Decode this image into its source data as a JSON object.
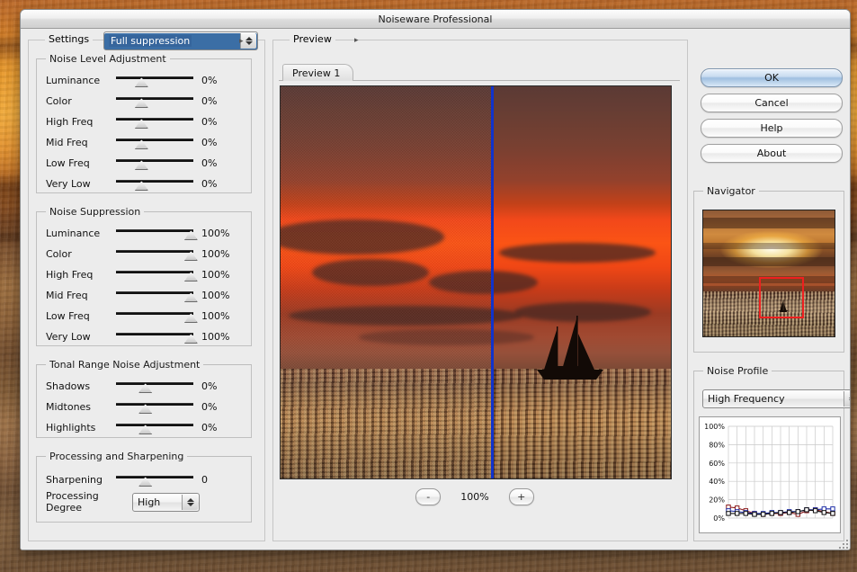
{
  "window": {
    "title": "Noiseware Professional"
  },
  "settings": {
    "group_label": "Settings",
    "preset_value": "Full suppression",
    "expand_arrow": "▸"
  },
  "noise_level": {
    "group_label": "Noise Level Adjustment",
    "rows": [
      {
        "label": "Luminance",
        "value": "0%",
        "pos": 33
      },
      {
        "label": "Color",
        "value": "0%",
        "pos": 33
      },
      {
        "label": "High Freq",
        "value": "0%",
        "pos": 33
      },
      {
        "label": "Mid Freq",
        "value": "0%",
        "pos": 33
      },
      {
        "label": "Low Freq",
        "value": "0%",
        "pos": 33
      },
      {
        "label": "Very Low",
        "value": "0%",
        "pos": 33
      }
    ]
  },
  "noise_suppression": {
    "group_label": "Noise Suppression",
    "rows": [
      {
        "label": "Luminance",
        "value": "100%",
        "pos": 97
      },
      {
        "label": "Color",
        "value": "100%",
        "pos": 97
      },
      {
        "label": "High Freq",
        "value": "100%",
        "pos": 97
      },
      {
        "label": "Mid Freq",
        "value": "100%",
        "pos": 97
      },
      {
        "label": "Low Freq",
        "value": "100%",
        "pos": 97
      },
      {
        "label": "Very Low",
        "value": "100%",
        "pos": 97
      }
    ]
  },
  "tonal_range": {
    "group_label": "Tonal Range Noise Adjustment",
    "rows": [
      {
        "label": "Shadows",
        "value": "0%",
        "pos": 38
      },
      {
        "label": "Midtones",
        "value": "0%",
        "pos": 38
      },
      {
        "label": "Highlights",
        "value": "0%",
        "pos": 38
      }
    ]
  },
  "processing": {
    "group_label": "Processing and Sharpening",
    "sharpening_label": "Sharpening",
    "sharpening_value": "0",
    "sharpening_pos": 38,
    "degree_label": "Processing Degree",
    "degree_value": "High"
  },
  "preview": {
    "group_label": "Preview",
    "expand_arrow": "▸",
    "tabs": [
      {
        "label": "Preview 1",
        "active": true
      }
    ],
    "zoom_out_label": "-",
    "zoom_in_label": "+",
    "zoom_value": "100%"
  },
  "buttons": [
    {
      "label": "OK",
      "default": true
    },
    {
      "label": "Cancel",
      "default": false
    },
    {
      "label": "Help",
      "default": false
    },
    {
      "label": "About",
      "default": false
    }
  ],
  "navigator": {
    "group_label": "Navigator"
  },
  "noise_profile": {
    "group_label": "Noise Profile",
    "selected_band": "High Frequency"
  },
  "chart_data": {
    "type": "line",
    "title": "Noise Profile",
    "xlabel": "",
    "ylabel": "",
    "ylim": [
      0,
      100
    ],
    "yticks": [
      0,
      20,
      40,
      60,
      80,
      100
    ],
    "ytick_labels": [
      "0%",
      "20%",
      "40%",
      "60%",
      "80%",
      "100%"
    ],
    "grid": true,
    "legend": "none",
    "x": [
      1,
      2,
      3,
      4,
      5,
      6,
      7,
      8,
      9,
      10,
      11,
      12,
      13
    ],
    "series": [
      {
        "name": "red",
        "color": "#8b1a1a",
        "values": [
          12,
          11,
          8,
          5,
          4,
          5,
          5,
          6,
          4,
          8,
          9,
          7,
          5
        ]
      },
      {
        "name": "blue",
        "color": "#1f2fa8",
        "values": [
          8,
          7,
          6,
          5,
          5,
          6,
          6,
          7,
          7,
          9,
          9,
          10,
          10
        ]
      },
      {
        "name": "black",
        "color": "#101010",
        "values": [
          5,
          5,
          5,
          4,
          4,
          5,
          6,
          6,
          7,
          9,
          8,
          6,
          5
        ]
      }
    ]
  },
  "colors": {
    "divider": "#1033cc",
    "nav_rect": "#ef1f1f",
    "accent_select": "#36659c"
  }
}
